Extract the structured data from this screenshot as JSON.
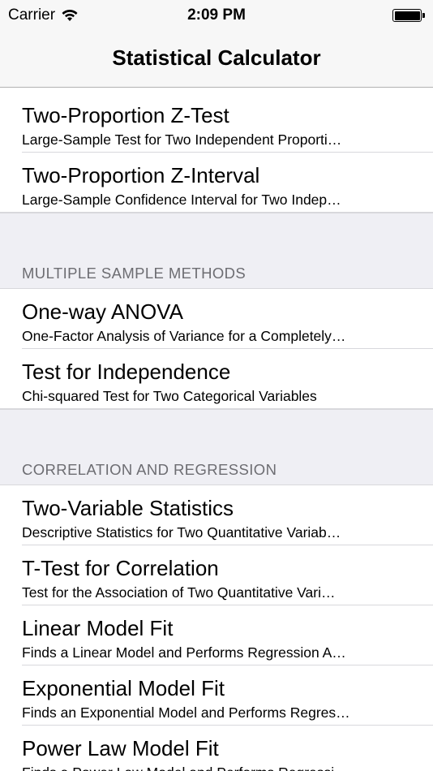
{
  "status_bar": {
    "carrier": "Carrier",
    "time": "2:09 PM"
  },
  "nav": {
    "title": "Statistical Calculator"
  },
  "sections": [
    {
      "header": "",
      "items": [
        {
          "title": "Two-Proportion Z-Test",
          "subtitle": "Large-Sample Test for Two Independent Proporti…"
        },
        {
          "title": "Two-Proportion Z-Interval",
          "subtitle": "Large-Sample Confidence Interval for Two Indep…"
        }
      ]
    },
    {
      "header": "MULTIPLE SAMPLE METHODS",
      "items": [
        {
          "title": "One-way ANOVA",
          "subtitle": "One-Factor Analysis of Variance for a Completely…"
        },
        {
          "title": "Test for Independence",
          "subtitle": "Chi-squared Test for Two Categorical Variables"
        }
      ]
    },
    {
      "header": "CORRELATION AND REGRESSION",
      "items": [
        {
          "title": "Two-Variable Statistics",
          "subtitle": "Descriptive Statistics for Two Quantitative Variab…"
        },
        {
          "title": "T-Test for Correlation",
          "subtitle": "Test for the Association of Two Quantitative Vari…"
        },
        {
          "title": "Linear Model Fit",
          "subtitle": "Finds a Linear Model and Performs Regression A…"
        },
        {
          "title": "Exponential Model Fit",
          "subtitle": "Finds an Exponential Model and Performs Regres…"
        },
        {
          "title": "Power Law Model Fit",
          "subtitle": "Finds a Power Law Model and Performs Regressi…"
        }
      ]
    }
  ]
}
